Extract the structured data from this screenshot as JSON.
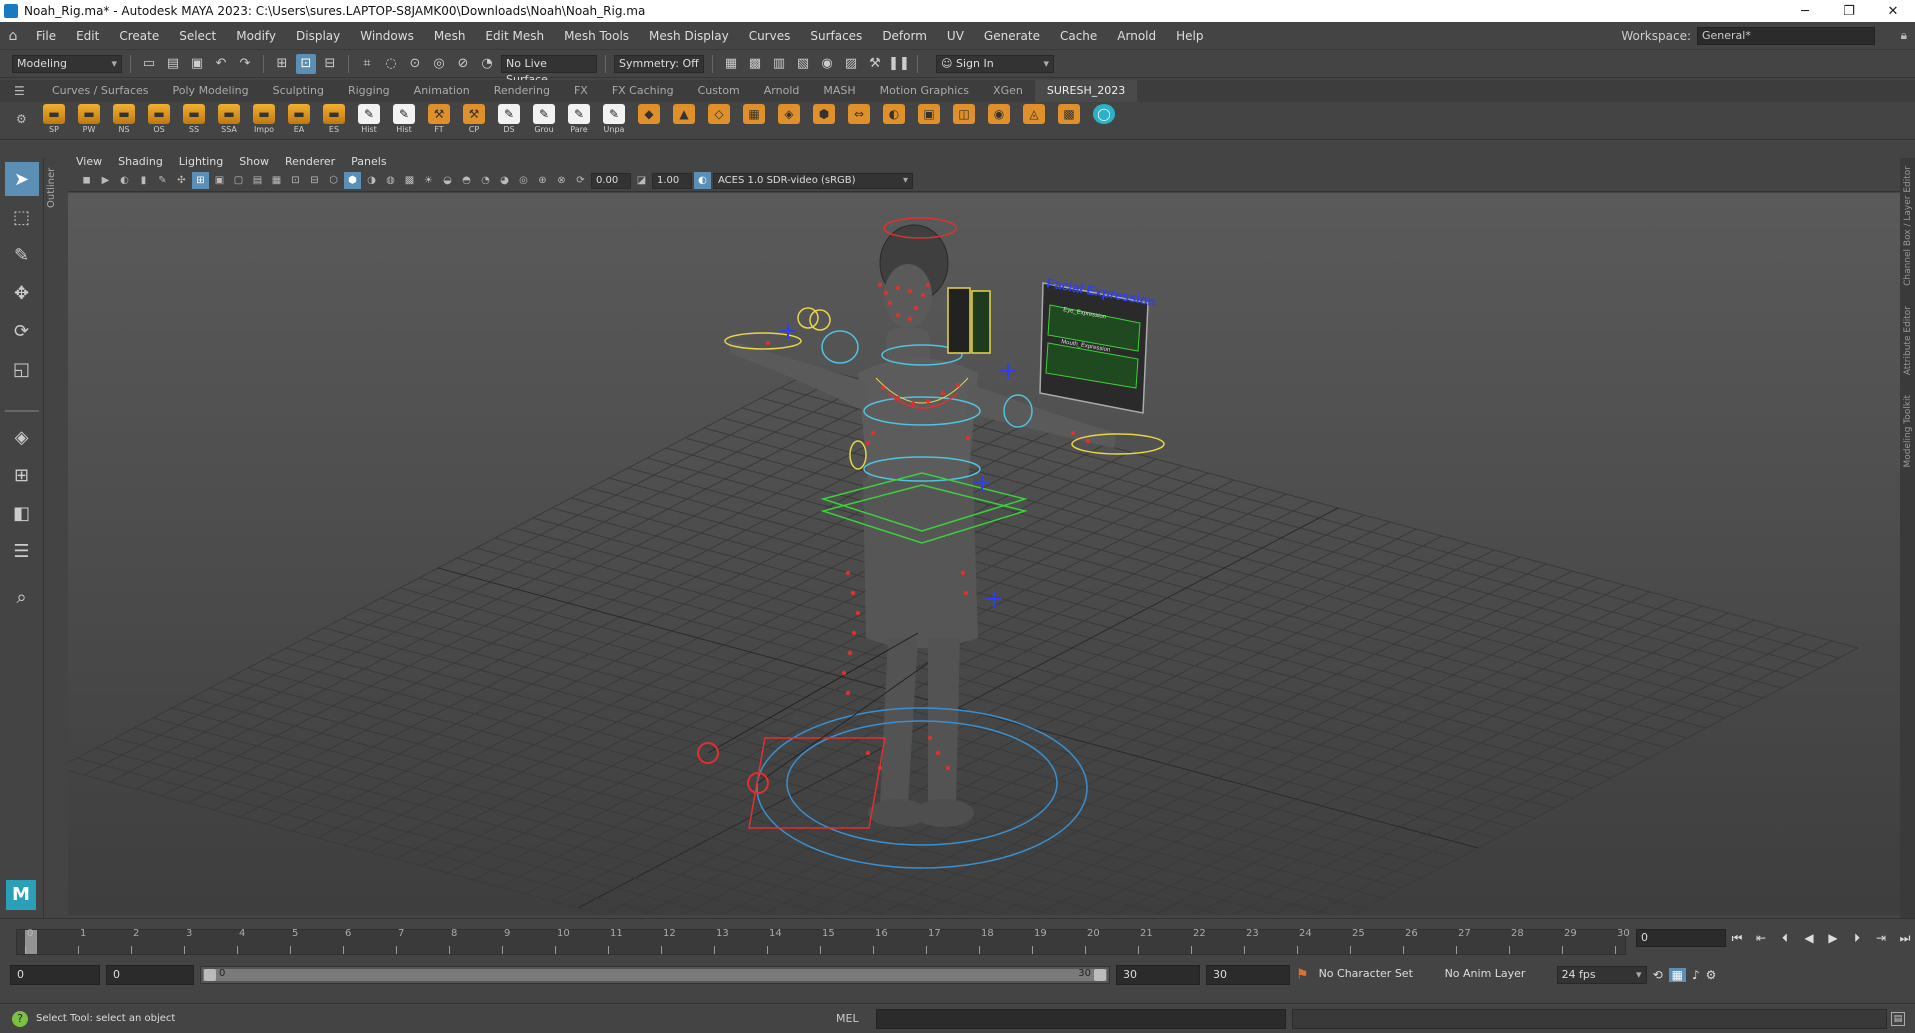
{
  "window": {
    "title": "Noah_Rig.ma* - Autodesk MAYA 2023: C:\\Users\\sures.LAPTOP-S8JAMK00\\Downloads\\Noah\\Noah_Rig.ma",
    "minimize": "─",
    "maximize": "❐",
    "close": "✕"
  },
  "menu": [
    "File",
    "Edit",
    "Create",
    "Select",
    "Modify",
    "Display",
    "Windows",
    "Mesh",
    "Edit Mesh",
    "Mesh Tools",
    "Mesh Display",
    "Curves",
    "Surfaces",
    "Deform",
    "UV",
    "Generate",
    "Cache",
    "Arnold",
    "Help"
  ],
  "workspace": {
    "label": "Workspace:",
    "value": "General*"
  },
  "status": {
    "mode": "Modeling",
    "live_surface": "No Live Surface",
    "symmetry": "Symmetry: Off",
    "sign_in": "Sign In"
  },
  "shelf_tabs": [
    "Curves / Surfaces",
    "Poly Modeling",
    "Sculpting",
    "Rigging",
    "Animation",
    "Rendering",
    "FX",
    "FX Caching",
    "Custom",
    "Arnold",
    "MASH",
    "Motion Graphics",
    "XGen",
    "SURESH_2023"
  ],
  "shelf_active": "SURESH_2023",
  "shelf_buttons": [
    {
      "label": "SP",
      "kind": "folder"
    },
    {
      "label": "PW",
      "kind": "folder"
    },
    {
      "label": "NS",
      "kind": "folder"
    },
    {
      "label": "OS",
      "kind": "folder"
    },
    {
      "label": "SS",
      "kind": "folder"
    },
    {
      "label": "SSA",
      "kind": "folder"
    },
    {
      "label": "Impo",
      "kind": "folder"
    },
    {
      "label": "EA",
      "kind": "folder"
    },
    {
      "label": "ES",
      "kind": "folder"
    },
    {
      "label": "Hist",
      "kind": "paper"
    },
    {
      "label": "Hist",
      "kind": "paper"
    },
    {
      "label": "FT",
      "kind": "tool"
    },
    {
      "label": "CP",
      "kind": "tool"
    },
    {
      "label": "DS",
      "kind": "paper"
    },
    {
      "label": "Grou",
      "kind": "paper"
    },
    {
      "label": "Pare",
      "kind": "paper"
    },
    {
      "label": "Unpa",
      "kind": "paper"
    }
  ],
  "outliner_label": "Outliner",
  "view_menu": [
    "View",
    "Shading",
    "Lighting",
    "Show",
    "Renderer",
    "Panels"
  ],
  "viewport_fields": {
    "near": "0.00",
    "gamma": "1.00",
    "color_space": "ACES 1.0 SDR-video (sRGB)"
  },
  "facial_panel": {
    "title": "Facial Expression",
    "sub1": "Eye_Expression",
    "sub2": "Mouth_Expression"
  },
  "right_tabs": [
    "Channel Box / Layer Editor",
    "Attribute Editor",
    "Modeling Toolkit"
  ],
  "timeline": {
    "start": 0,
    "end": 30,
    "current_frame": "0",
    "ticks": [
      "0",
      "1",
      "2",
      "3",
      "4",
      "5",
      "6",
      "7",
      "8",
      "9",
      "10",
      "11",
      "12",
      "13",
      "14",
      "15",
      "16",
      "17",
      "18",
      "19",
      "20",
      "21",
      "22",
      "23",
      "24",
      "25",
      "26",
      "27",
      "28",
      "29",
      "30"
    ]
  },
  "range": {
    "start": "0",
    "anim_start": "0",
    "range_lo": "0",
    "range_hi": "30",
    "anim_end": "30",
    "end": "30",
    "character_set": "No Character Set",
    "anim_layer": "No Anim Layer",
    "fps": "24 fps"
  },
  "help_line": "Select Tool: select an object",
  "cmd_lang": "MEL",
  "colors": {
    "accent": "#5b8fb6",
    "ctrl_red": "#e03030",
    "ctrl_yellow": "#e8d44a",
    "ctrl_cyan": "#4fc3e0",
    "ctrl_green": "#3bd13b",
    "ctrl_blue": "#2f3ff0"
  }
}
